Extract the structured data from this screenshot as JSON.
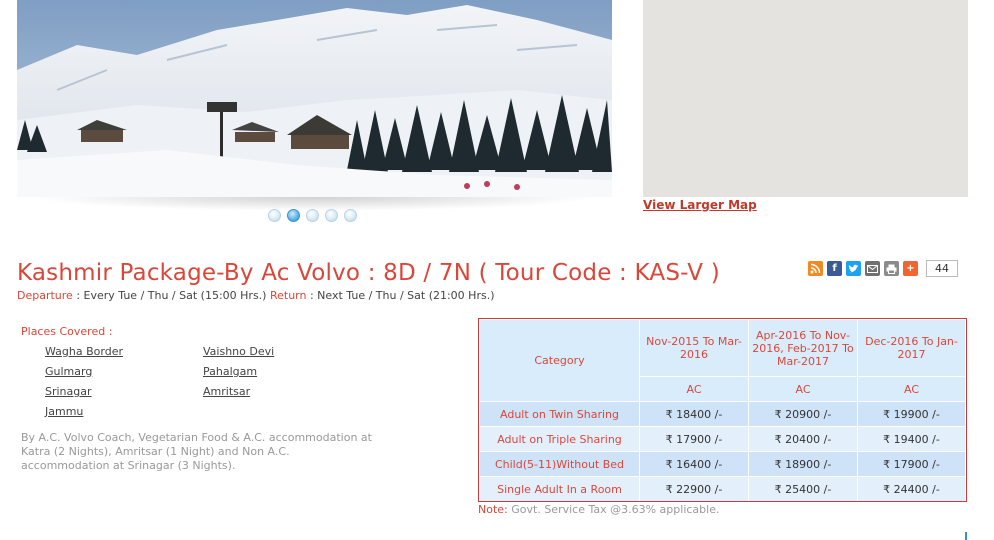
{
  "map": {
    "link_label": "View Larger Map"
  },
  "slider": {
    "dot_count": 5,
    "active_index": 1
  },
  "tour": {
    "title": "Kashmir Package-By Ac Volvo : 8D / 7N ( Tour Code : KAS-V )",
    "departure_label": "Departure",
    "departure_value": " : Every Tue / Thu / Sat (15:00 Hrs.) ",
    "return_label": "Return",
    "return_value": " : Next Tue / Thu / Sat (21:00 Hrs.)"
  },
  "share": {
    "icons": [
      "rss-icon",
      "facebook-icon",
      "twitter-icon",
      "email-icon",
      "print-icon",
      "plus-icon"
    ],
    "count": "44"
  },
  "places": {
    "label": "Places Covered :",
    "items": [
      "Wagha Border",
      "Vaishno Devi",
      "Gulmarg",
      "Pahalgam",
      "Srinagar",
      "Amritsar",
      "Jammu"
    ]
  },
  "description": "By A.C. Volvo Coach, Vegetarian Food & A.C. accommodation at Katra (2 Nights), Amritsar (1 Night) and Non A.C. accommodation at Srinagar (3 Nights).",
  "pricing": {
    "category_header": "Category",
    "periods": [
      "Nov-2015 To Mar-2016",
      "Apr-2016 To Nov-2016, Feb-2017 To Mar-2017",
      "Dec-2016 To Jan-2017"
    ],
    "sub_header": [
      "AC",
      "AC",
      "AC"
    ],
    "rows": [
      {
        "category": "Adult on Twin Sharing",
        "prices": [
          "₹ 18400 /-",
          "₹ 20900 /-",
          "₹ 19900 /-"
        ]
      },
      {
        "category": "Adult on Triple Sharing",
        "prices": [
          "₹ 17900 /-",
          "₹ 20400 /-",
          "₹ 19400 /-"
        ]
      },
      {
        "category": "Child(5-11)Without Bed",
        "prices": [
          "₹ 16400 /-",
          "₹ 18900 /-",
          "₹ 17900 /-"
        ]
      },
      {
        "category": "Single Adult In a Room",
        "prices": [
          "₹ 22900 /-",
          "₹ 25400 /-",
          "₹ 24400 /-"
        ]
      }
    ]
  },
  "note": {
    "label": "Note:",
    "text": " Govt. Service Tax @3.63% applicable."
  }
}
